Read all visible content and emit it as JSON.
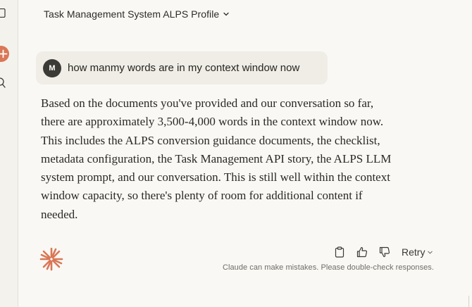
{
  "header": {
    "title": "Task Management System ALPS Profile"
  },
  "sidebar": {
    "icons": [
      "sidebar-toggle-icon",
      "new-chat-icon",
      "search-icon"
    ]
  },
  "user_message": {
    "avatar_initial": "M",
    "text": "how manmy words are in my context window now"
  },
  "assistant_message": {
    "lines": [
      "Based on the documents you've provided and our conversation so far,",
      "there are approximately 3,500-4,000 words in the context window now.",
      "This includes the ALPS conversion guidance documents, the checklist,",
      "metadata configuration, the Task Management API story, the ALPS LLM",
      "system prompt, and our conversation. This is still well within the context",
      "window capacity, so there's plenty of room for additional content if",
      "needed."
    ]
  },
  "actions": {
    "copy_icon": "copy-icon",
    "thumbs_up_icon": "thumbs-up-icon",
    "thumbs_down_icon": "thumbs-down-icon",
    "retry_label": "Retry"
  },
  "disclaimer": "Claude can make mistakes. Please double-check responses.",
  "colors": {
    "accent": "#d97757",
    "background": "#f9f8f4",
    "bubble": "#efede6",
    "avatar": "#3b3a36"
  }
}
